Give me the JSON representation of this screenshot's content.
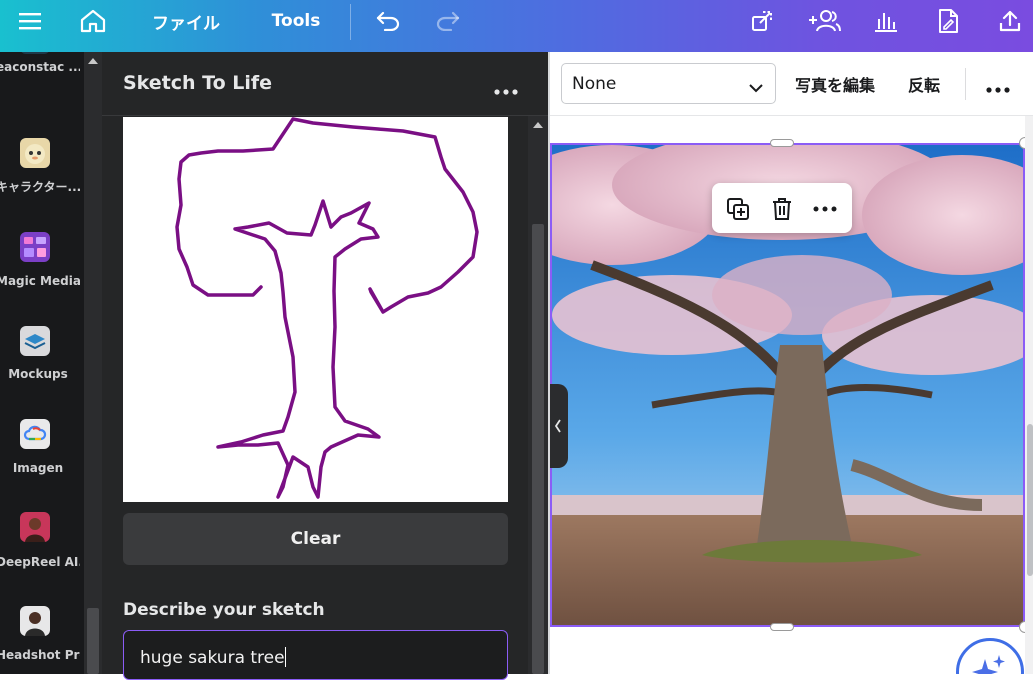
{
  "topbar": {
    "menu_icon": "hamburger-icon",
    "home_icon": "home-icon",
    "file_label": "ファイル",
    "tools_label": "Tools",
    "undo_icon": "undo-icon",
    "redo_icon": "redo-icon",
    "right_icons": [
      "resize-icon",
      "share-people-icon",
      "chart-icon",
      "file-edit-icon",
      "upload-icon"
    ]
  },
  "rail": {
    "items": [
      {
        "label": "eaconstac ...",
        "icon": "app-icon",
        "color": "#1f3a4a"
      },
      {
        "label": "キャラクター...",
        "icon": "character-face-icon",
        "color": "#e8d7a8"
      },
      {
        "label": "Magic Media",
        "icon": "magic-media-icon",
        "color": "#7b3fc6"
      },
      {
        "label": "Mockups",
        "icon": "mockups-layers-icon",
        "color": "#2e88c8"
      },
      {
        "label": "Imagen",
        "icon": "imagen-cloud-icon",
        "color": "#e9e9ea"
      },
      {
        "label": "DeepReel AI...",
        "icon": "avatar-icon",
        "color": "#c8365a"
      },
      {
        "label": "Headshot Pro",
        "icon": "avatar-icon",
        "color": "#e7e7e8"
      }
    ]
  },
  "panel": {
    "title": "Sketch To Life",
    "clear_label": "Clear",
    "describe_label": "Describe your sketch",
    "describe_value": "huge sakura tree",
    "sketch_color": "#7a0f84"
  },
  "context": {
    "dropdown_value": "None",
    "edit_photo_label": "写真を編集",
    "flip_label": "反転"
  },
  "accent": "#8b5cf6"
}
